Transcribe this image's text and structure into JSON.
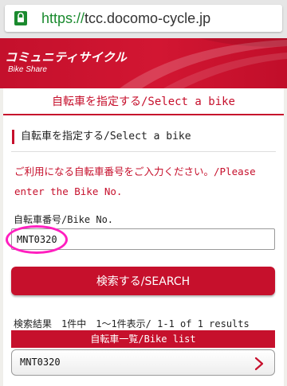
{
  "browser": {
    "url_scheme": "https://",
    "url_host": "tcc.docomo-cycle.jp",
    "lock_icon": "lock-icon",
    "secure_color": "#1a8a2e"
  },
  "banner": {
    "title_ja": "コミュニティサイクル",
    "subtitle_en": "Bike Share",
    "brand_color": "#c6102c"
  },
  "page": {
    "heading": "自転車を指定する/Select a bike",
    "section_title": "自転車を指定する/Select a bike",
    "instruction": "ご利用になる自転車番号をご入力ください。/Please enter the Bike No."
  },
  "form": {
    "bike_no_label": "自転車番号/Bike No.",
    "bike_no_value": "MNT0320",
    "search_label": "検索する/SEARCH"
  },
  "results": {
    "summary": "検索結果　1件中　1〜1件表示/ 1-1 of 1 results",
    "list_header": "自転車一覧/Bike list",
    "items": [
      {
        "label": "MNT0320",
        "icon": "chevron-right-icon"
      }
    ]
  },
  "annotation": {
    "highlight_color": "#ff1fbf"
  }
}
